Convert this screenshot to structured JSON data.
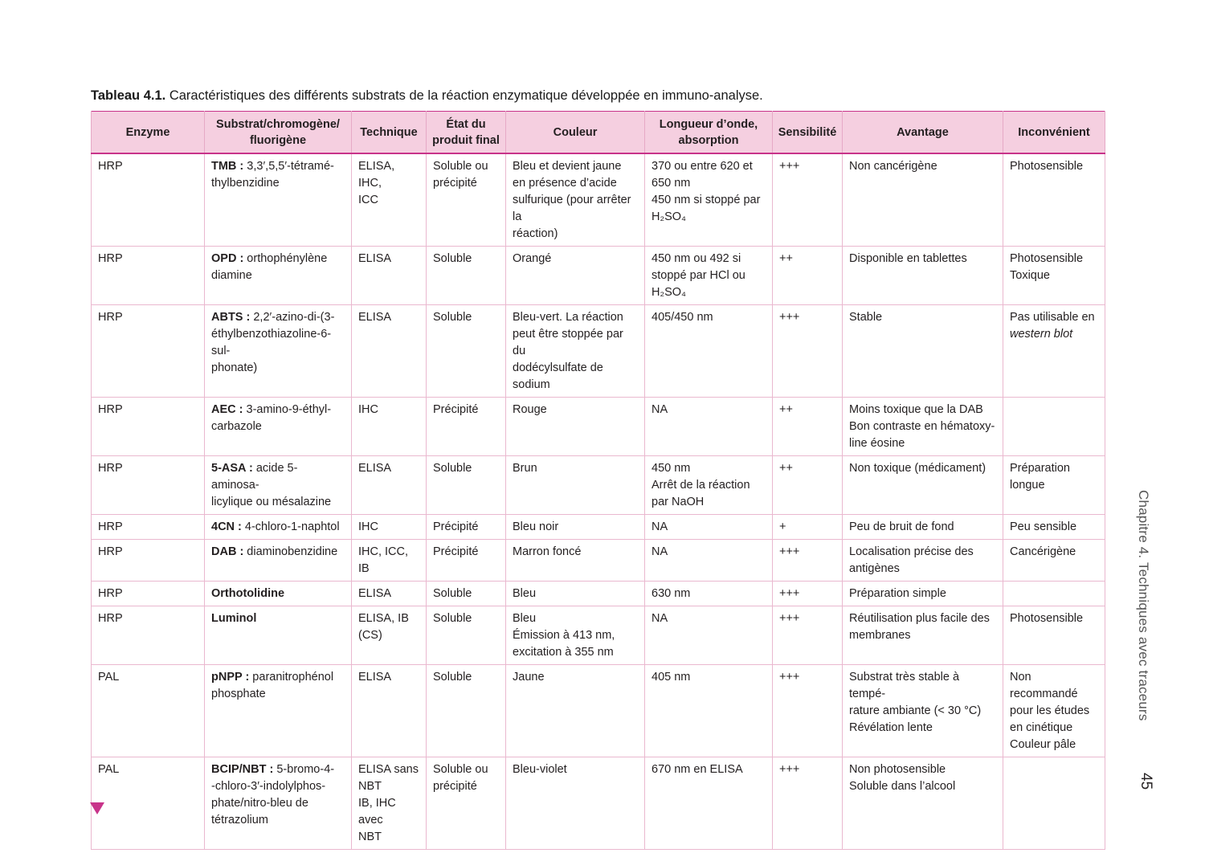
{
  "caption": {
    "label": "Tableau 4.1.",
    "text": " Caractéristiques des différents substrats de la réaction enzymatique développée en immuno-analyse."
  },
  "table": {
    "headers": [
      "Enzyme",
      "Substrat/chromogène/\nfluorigène",
      "Technique",
      "État du\nproduit final",
      "Couleur",
      "Longueur d’onde,\nabsorption",
      "Sensibilité",
      "Avantage",
      "Inconvénient"
    ],
    "rows": [
      {
        "enzyme": "HRP",
        "substrate_name": "TMB :",
        "substrate_desc": " 3,3′,5,5′-tétramé-\nthylbenzidine",
        "technique": "ELISA, IHC,\nICC",
        "etat": "Soluble ou\nprécipité",
        "couleur": "Bleu et devient jaune\nen présence d’acide\nsulfurique (pour arrêter la\nréaction)",
        "longueur": "370 ou entre 620 et\n650 nm\n450 nm si stoppé par\nH₂SO₄",
        "sensibilite": "+++",
        "avantage": "Non cancérigène",
        "inconvenient": "Photosensible"
      },
      {
        "enzyme": "HRP",
        "substrate_name": "OPD :",
        "substrate_desc": " orthophénylène\ndiamine",
        "technique": "ELISA",
        "etat": "Soluble",
        "couleur": "Orangé",
        "longueur": "450 nm ou 492 si\nstoppé par HCl ou\nH₂SO₄",
        "sensibilite": "++",
        "avantage": "Disponible en tablettes",
        "inconvenient": "Photosensible\nToxique"
      },
      {
        "enzyme": "HRP",
        "substrate_name": "ABTS :",
        "substrate_desc": " 2,2′-azino-di-(3-\néthylbenzothiazoline-6-sul-\nphonate)",
        "technique": "ELISA",
        "etat": "Soluble",
        "couleur": "Bleu-vert. La réaction\npeut être stoppée par du\ndodécylsulfate de sodium",
        "longueur": "405/450 nm",
        "sensibilite": "+++",
        "avantage": "Stable",
        "inconvenient": "Pas utilisable en",
        "inconvenient_italic": "western blot"
      },
      {
        "enzyme": "HRP",
        "substrate_name": "AEC :",
        "substrate_desc": " 3-amino-9-éthyl-\ncarbazole",
        "technique": "IHC",
        "etat": "Précipité",
        "couleur": "Rouge",
        "longueur": "NA",
        "sensibilite": "++",
        "avantage": "Moins toxique que la DAB\nBon contraste en hématoxy-\nline éosine",
        "inconvenient": ""
      },
      {
        "enzyme": "HRP",
        "substrate_name": "5-ASA :",
        "substrate_desc": " acide 5-aminosa-\nlicylique ou mésalazine",
        "technique": "ELISA",
        "etat": "Soluble",
        "couleur": "Brun",
        "longueur": "450 nm\nArrêt de la réaction\npar NaOH",
        "sensibilite": "++",
        "avantage": "Non toxique (médicament)",
        "inconvenient": "Préparation\nlongue"
      },
      {
        "enzyme": "HRP",
        "substrate_name": "4CN :",
        "substrate_desc": " 4-chloro-1-naphtol",
        "technique": "IHC",
        "etat": "Précipité",
        "couleur": "Bleu noir",
        "longueur": "NA",
        "sensibilite": "+",
        "avantage": "Peu de bruit de fond",
        "inconvenient": "Peu sensible"
      },
      {
        "enzyme": "HRP",
        "substrate_name": "DAB :",
        "substrate_desc": " diaminobenzidine",
        "technique": "IHC, ICC, IB",
        "etat": "Précipité",
        "couleur": "Marron foncé",
        "longueur": "NA",
        "sensibilite": "+++",
        "avantage": "Localisation précise des\nantigènes",
        "inconvenient": "Cancérigène"
      },
      {
        "enzyme": "HRP",
        "substrate_name": "Orthotolidine",
        "substrate_desc": "",
        "technique": "ELISA",
        "etat": "Soluble",
        "couleur": "Bleu",
        "longueur": "630 nm",
        "sensibilite": "+++",
        "avantage": "Préparation simple",
        "inconvenient": ""
      },
      {
        "enzyme": "HRP",
        "substrate_name": "Luminol",
        "substrate_desc": "",
        "technique": "ELISA, IB\n(CS)",
        "etat": "Soluble",
        "couleur": "Bleu\nÉmission à 413 nm,\nexcitation à 355 nm",
        "longueur": "NA",
        "sensibilite": "+++",
        "avantage": "Réutilisation plus facile des\nmembranes",
        "inconvenient": "Photosensible"
      },
      {
        "enzyme": "PAL",
        "substrate_name": "pNPP :",
        "substrate_desc": " paranitrophénol\nphosphate",
        "technique": "ELISA",
        "etat": "Soluble",
        "couleur": "Jaune",
        "longueur": "405 nm",
        "sensibilite": "+++",
        "avantage": "Substrat très stable à tempé-\nrature ambiante (< 30 °C)\nRévélation lente",
        "inconvenient": "Non recommandé\npour les études\nen cinétique\nCouleur pâle"
      },
      {
        "enzyme": "PAL",
        "substrate_name": "BCIP/NBT :",
        "substrate_desc": " 5-bromo-4-\n-chloro-3′-indolylphos-\nphate/nitro-bleu de\ntétrazolium",
        "technique": "ELISA sans\nNBT\nIB, IHC avec\nNBT",
        "etat": "Soluble ou\nprécipité",
        "couleur": "Bleu-violet",
        "longueur": "670 nm en ELISA",
        "sensibilite": "+++",
        "avantage": "Non photosensible\nSoluble dans l’alcool",
        "inconvenient": ""
      }
    ]
  },
  "sidebar": {
    "chapter": "Chapitre 4. Techniques avec traceurs",
    "page_number": "45"
  },
  "colors": {
    "accent": "#c8338a",
    "header_bg": "#f5cfe0",
    "row_border": "#eab8cf"
  },
  "icons": {
    "page_marker": "triangle-down-icon"
  }
}
